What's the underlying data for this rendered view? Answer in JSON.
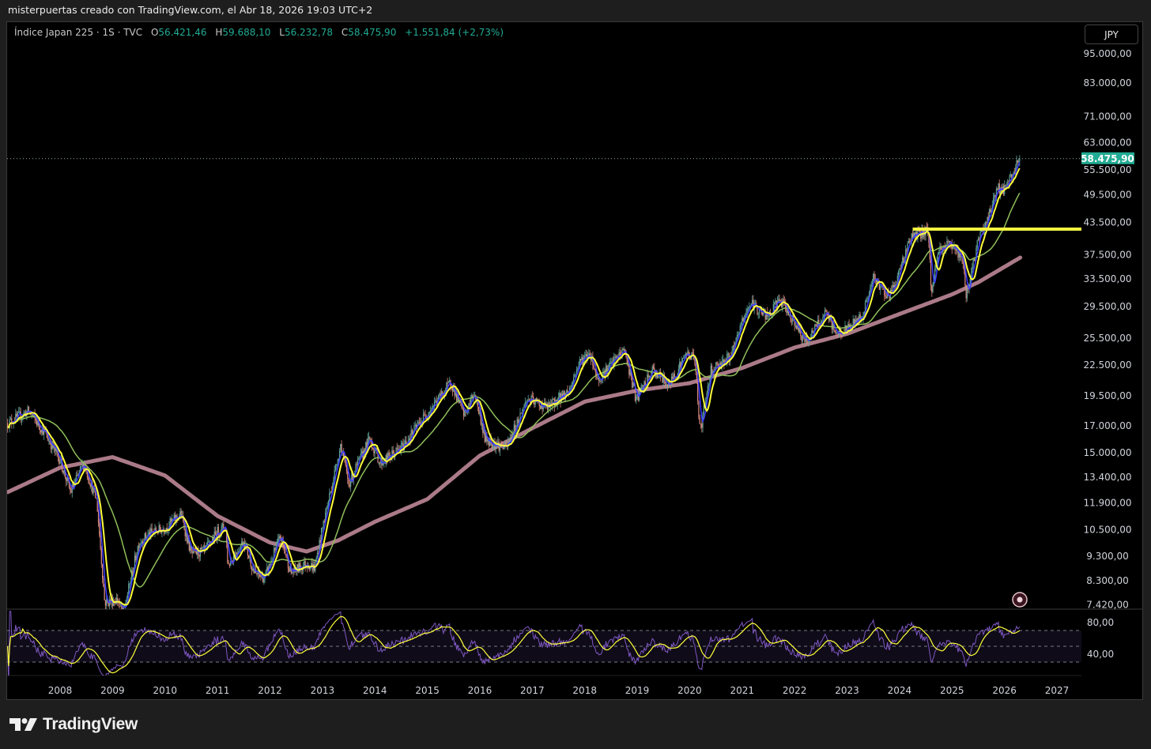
{
  "header": {
    "snapshot_caption": "misterpuertas creado con TradingView.com, el Abr 18, 2026 19:03 UTC+2"
  },
  "legend": {
    "symbol": "Índice Japan 225 · 1S · TVC",
    "open_label": "O",
    "open": "56.421,46",
    "high_label": "H",
    "high": "59.688,10",
    "low_label": "L",
    "low": "56.232,78",
    "close_label": "C",
    "close": "58.475,90",
    "change": "+1.551,84 (+2,73%)"
  },
  "currency_button": "JPY",
  "last_price_badge": "58.475,90",
  "footer": {
    "brand": "TradingView"
  },
  "colors": {
    "up": "#5fa39a",
    "down": "#d98a7f",
    "ma_fast": "#3b3bff",
    "ma_yellow": "#ffff3c",
    "ma_green": "#8fbf5a",
    "ma_long": "#c98fa0",
    "hline": "#f5f542",
    "badge": "#22ab94",
    "rsi": "#7e57c2"
  },
  "chart_data": {
    "type": "candlestick",
    "title": "Índice Japan 225 · 1S · TVC",
    "scale": "log",
    "ylim": [
      7420,
      95000
    ],
    "xlim": [
      2007.0,
      2027.6
    ],
    "price_ticks": [
      {
        "value": 95000,
        "label": "95.000,00"
      },
      {
        "value": 83000,
        "label": "83.000,00"
      },
      {
        "value": 71000,
        "label": "71.000,00"
      },
      {
        "value": 63000,
        "label": "63.000,00"
      },
      {
        "value": 55500,
        "label": "55.500,00"
      },
      {
        "value": 49500,
        "label": "49.500,00"
      },
      {
        "value": 43500,
        "label": "43.500,00"
      },
      {
        "value": 37500,
        "label": "37.500,00"
      },
      {
        "value": 33500,
        "label": "33.500,00"
      },
      {
        "value": 29500,
        "label": "29.500,00"
      },
      {
        "value": 25500,
        "label": "25.500,00"
      },
      {
        "value": 22500,
        "label": "22.500,00"
      },
      {
        "value": 19500,
        "label": "19.500,00"
      },
      {
        "value": 17000,
        "label": "17.000,00"
      },
      {
        "value": 15000,
        "label": "15.000,00"
      },
      {
        "value": 13400,
        "label": "13.400,00"
      },
      {
        "value": 11900,
        "label": "11.900,00"
      },
      {
        "value": 10500,
        "label": "10.500,00"
      },
      {
        "value": 9300,
        "label": "9.300,00"
      },
      {
        "value": 8300,
        "label": "8.300,00"
      },
      {
        "value": 7420,
        "label": "7.420,00"
      }
    ],
    "time_ticks": [
      "2008",
      "2009",
      "2010",
      "2011",
      "2012",
      "2013",
      "2014",
      "2015",
      "2016",
      "2017",
      "2018",
      "2019",
      "2020",
      "2021",
      "2022",
      "2023",
      "2024",
      "2025",
      "2026",
      "2027"
    ],
    "last_price": 58475.9,
    "price_keypoints": [
      [
        2007.0,
        17200
      ],
      [
        2007.4,
        18200
      ],
      [
        2007.7,
        16500
      ],
      [
        2008.0,
        14500
      ],
      [
        2008.2,
        12500
      ],
      [
        2008.45,
        14300
      ],
      [
        2008.7,
        12000
      ],
      [
        2008.85,
        7500
      ],
      [
        2009.1,
        7600
      ],
      [
        2009.2,
        7100
      ],
      [
        2009.5,
        9900
      ],
      [
        2009.7,
        10300
      ],
      [
        2010.0,
        10600
      ],
      [
        2010.3,
        11300
      ],
      [
        2010.5,
        9400
      ],
      [
        2010.75,
        9500
      ],
      [
        2011.0,
        10400
      ],
      [
        2011.15,
        10700
      ],
      [
        2011.2,
        8900
      ],
      [
        2011.5,
        10000
      ],
      [
        2011.7,
        8600
      ],
      [
        2011.9,
        8400
      ],
      [
        2012.2,
        10200
      ],
      [
        2012.4,
        8600
      ],
      [
        2012.7,
        9000
      ],
      [
        2012.85,
        8800
      ],
      [
        2013.0,
        10600
      ],
      [
        2013.35,
        15600
      ],
      [
        2013.5,
        13000
      ],
      [
        2013.9,
        16000
      ],
      [
        2014.1,
        14300
      ],
      [
        2014.5,
        15300
      ],
      [
        2014.9,
        17500
      ],
      [
        2015.2,
        19200
      ],
      [
        2015.45,
        20800
      ],
      [
        2015.7,
        17800
      ],
      [
        2015.9,
        19800
      ],
      [
        2016.1,
        16000
      ],
      [
        2016.5,
        15300
      ],
      [
        2016.9,
        19200
      ],
      [
        2017.3,
        18500
      ],
      [
        2017.7,
        20000
      ],
      [
        2017.9,
        22800
      ],
      [
        2018.1,
        23800
      ],
      [
        2018.25,
        21000
      ],
      [
        2018.75,
        24200
      ],
      [
        2018.98,
        19200
      ],
      [
        2019.3,
        22000
      ],
      [
        2019.6,
        20500
      ],
      [
        2019.95,
        23800
      ],
      [
        2020.1,
        23200
      ],
      [
        2020.2,
        16500
      ],
      [
        2020.4,
        22000
      ],
      [
        2020.8,
        23500
      ],
      [
        2021.0,
        27500
      ],
      [
        2021.15,
        30000
      ],
      [
        2021.5,
        28000
      ],
      [
        2021.7,
        30500
      ],
      [
        2022.0,
        27500
      ],
      [
        2022.2,
        25000
      ],
      [
        2022.6,
        28500
      ],
      [
        2022.8,
        26000
      ],
      [
        2023.0,
        26500
      ],
      [
        2023.3,
        28500
      ],
      [
        2023.5,
        33500
      ],
      [
        2023.8,
        31000
      ],
      [
        2023.95,
        33500
      ],
      [
        2024.2,
        40500
      ],
      [
        2024.55,
        42000
      ],
      [
        2024.6,
        31500
      ],
      [
        2024.75,
        38500
      ],
      [
        2025.0,
        39500
      ],
      [
        2025.2,
        36500
      ],
      [
        2025.27,
        31200
      ],
      [
        2025.5,
        40000
      ],
      [
        2025.7,
        45000
      ],
      [
        2025.85,
        51000
      ],
      [
        2026.0,
        50500
      ],
      [
        2026.15,
        54000
      ],
      [
        2026.25,
        58000
      ],
      [
        2026.3,
        58475.9
      ]
    ],
    "long_ma_keypoints": [
      [
        2007.0,
        12500
      ],
      [
        2008.0,
        14000
      ],
      [
        2009.0,
        14700
      ],
      [
        2010.0,
        13500
      ],
      [
        2011.0,
        11200
      ],
      [
        2012.0,
        9900
      ],
      [
        2012.7,
        9500
      ],
      [
        2013.3,
        10000
      ],
      [
        2014.0,
        10900
      ],
      [
        2015.0,
        12100
      ],
      [
        2016.0,
        14800
      ],
      [
        2017.0,
        16800
      ],
      [
        2018.0,
        19000
      ],
      [
        2019.0,
        20000
      ],
      [
        2020.0,
        20700
      ],
      [
        2021.0,
        22200
      ],
      [
        2022.0,
        24400
      ],
      [
        2023.0,
        26000
      ],
      [
        2024.0,
        28500
      ],
      [
        2025.0,
        31200
      ],
      [
        2025.5,
        33000
      ],
      [
        2026.3,
        37000
      ]
    ],
    "horizontal_line": {
      "price": 42200,
      "from": 2024.25
    },
    "rsi": {
      "ticks": [
        {
          "value": 80,
          "label": "80,00"
        },
        {
          "value": 40,
          "label": "40,00"
        }
      ],
      "upper_band": 70,
      "lower_band": 30,
      "mid": 50
    }
  }
}
